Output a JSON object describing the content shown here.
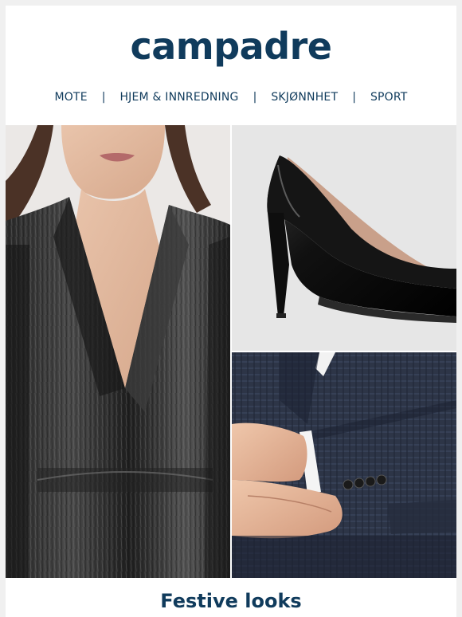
{
  "brand": {
    "logo_text": "campadre",
    "color": "#103b5c"
  },
  "nav": {
    "items": [
      "MOTE",
      "HJEM & INNREDNING",
      "SKJØNNHET",
      "SPORT"
    ],
    "separator": "|"
  },
  "hero": {
    "tiles": [
      {
        "image": "metallic-wrap-dress-photo"
      },
      {
        "image": "black-pump-shoe-photo"
      },
      {
        "image": "navy-check-suit-sleeve-photo"
      }
    ]
  },
  "headline": "Festive looks"
}
